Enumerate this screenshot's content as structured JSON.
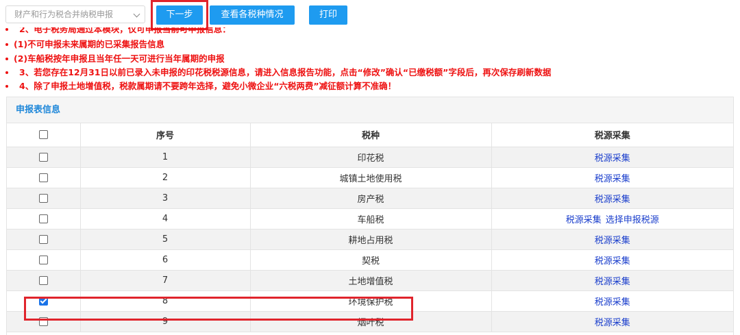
{
  "toolbar": {
    "select_value": "财产和行为税合并纳税申报",
    "next_label": "下一步",
    "view_label": "查看各税种情况",
    "print_label": "打印"
  },
  "notices": [
    "2、电子税务局通过本模块，仅可申报当前可申报信息：",
    "(1)不可申报未来属期的已采集报告信息",
    "(2)车船税按年申报且当年任一天可进行当年属期的申报",
    "3、若您存在12月31日以前已录入未申报的印花税税源信息，请进入信息报告功能，点击“修改”确认“已缴税额”字段后，再次保存刷新数据",
    "4、除了申报土地增值税，税款属期请不要跨年选择，避免小微企业“六税两费”减征额计算不准确！"
  ],
  "table": {
    "title": "申报表信息",
    "headers": {
      "seq": "序号",
      "tax": "税种",
      "source": "税源采集"
    },
    "rows": [
      {
        "seq": "1",
        "tax": "印花税",
        "links": [
          "税源采集"
        ],
        "checked": false
      },
      {
        "seq": "2",
        "tax": "城镇土地使用税",
        "links": [
          "税源采集"
        ],
        "checked": false
      },
      {
        "seq": "3",
        "tax": "房产税",
        "links": [
          "税源采集"
        ],
        "checked": false
      },
      {
        "seq": "4",
        "tax": "车船税",
        "links": [
          "税源采集",
          "选择申报税源"
        ],
        "checked": false
      },
      {
        "seq": "5",
        "tax": "耕地占用税",
        "links": [
          "税源采集"
        ],
        "checked": false
      },
      {
        "seq": "6",
        "tax": "契税",
        "links": [
          "税源采集"
        ],
        "checked": false
      },
      {
        "seq": "7",
        "tax": "土地增值税",
        "links": [
          "税源采集"
        ],
        "checked": false
      },
      {
        "seq": "8",
        "tax": "环境保护税",
        "links": [
          "税源采集"
        ],
        "checked": true
      },
      {
        "seq": "9",
        "tax": "烟叶税",
        "links": [
          "税源采集"
        ],
        "checked": false
      }
    ]
  },
  "colors": {
    "primary": "#1e9bf0",
    "notice": "#ee1111",
    "highlight": "#e0242c",
    "link": "#1a3ecc"
  }
}
